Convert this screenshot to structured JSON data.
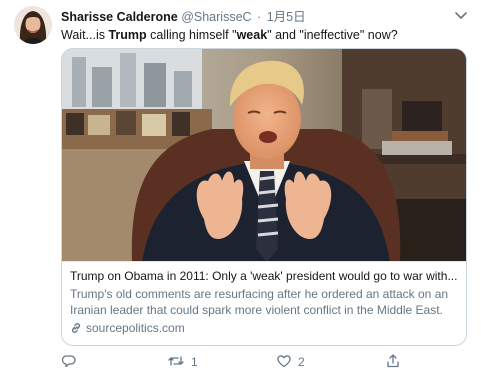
{
  "tweet": {
    "author_name": "Sharisse Calderone",
    "author_handle": "@SharisseC",
    "separator": "·",
    "timestamp": "1月5日",
    "text_before": "Wait...is ",
    "text_bold_1": "Trump",
    "text_middle": " calling himself \"",
    "text_bold_2": "weak",
    "text_after": "\" and \"ineffective\" now?"
  },
  "card": {
    "title": "Trump on Obama in 2011: Only a 'weak' president would go to war with...",
    "description": "Trump's old comments are resurfacing after he ordered an attack on an Iranian leader that could spark more violent conflict in the Middle East.",
    "domain": "sourcepolitics.com"
  },
  "actions": {
    "reply_count": "",
    "retweet_count": "1",
    "like_count": "2"
  },
  "colors": {
    "secondary_text": "#657786",
    "primary_text": "#14171a",
    "border": "#ccd6dd"
  },
  "icons": [
    "caret-down-icon",
    "link-icon",
    "reply-icon",
    "retweet-icon",
    "like-icon",
    "share-icon"
  ]
}
